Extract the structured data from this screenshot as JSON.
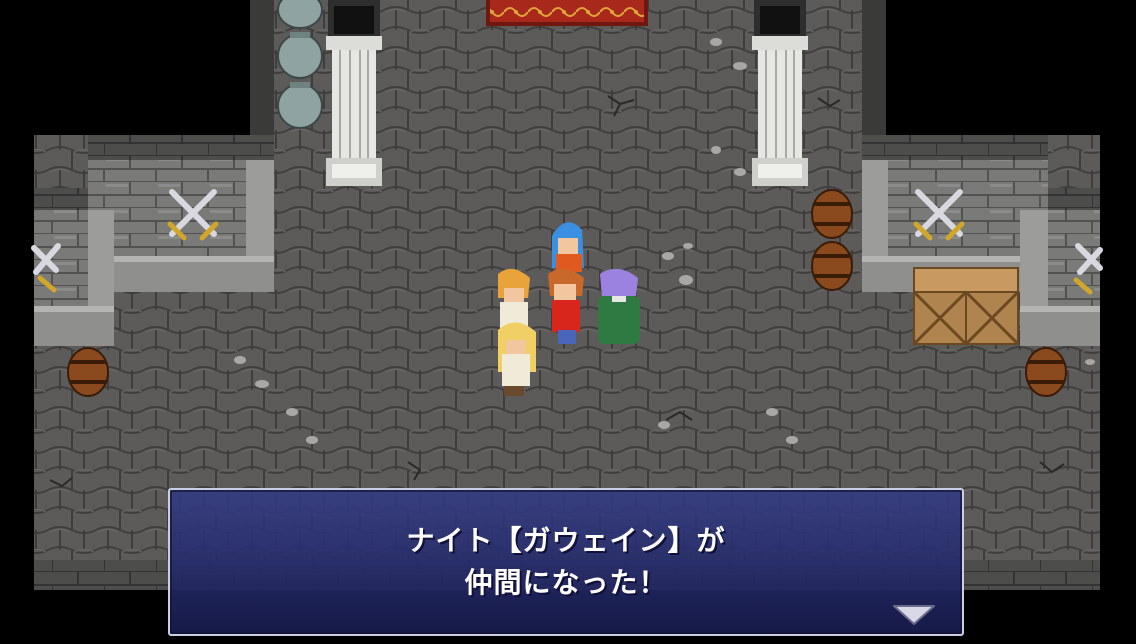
{
  "dialogue": {
    "line1": "ナイト【ガウェイン】が",
    "line2": "仲間になった！"
  },
  "icons": {
    "advance": "triangle-down-icon"
  },
  "colors": {
    "floor": "#5d5b5a",
    "wall": "#767676",
    "dialog_top": "#343c84",
    "dialog_bottom": "#181c4c",
    "dialog_border": "#c9cde6",
    "carpet": "#a8281c"
  }
}
